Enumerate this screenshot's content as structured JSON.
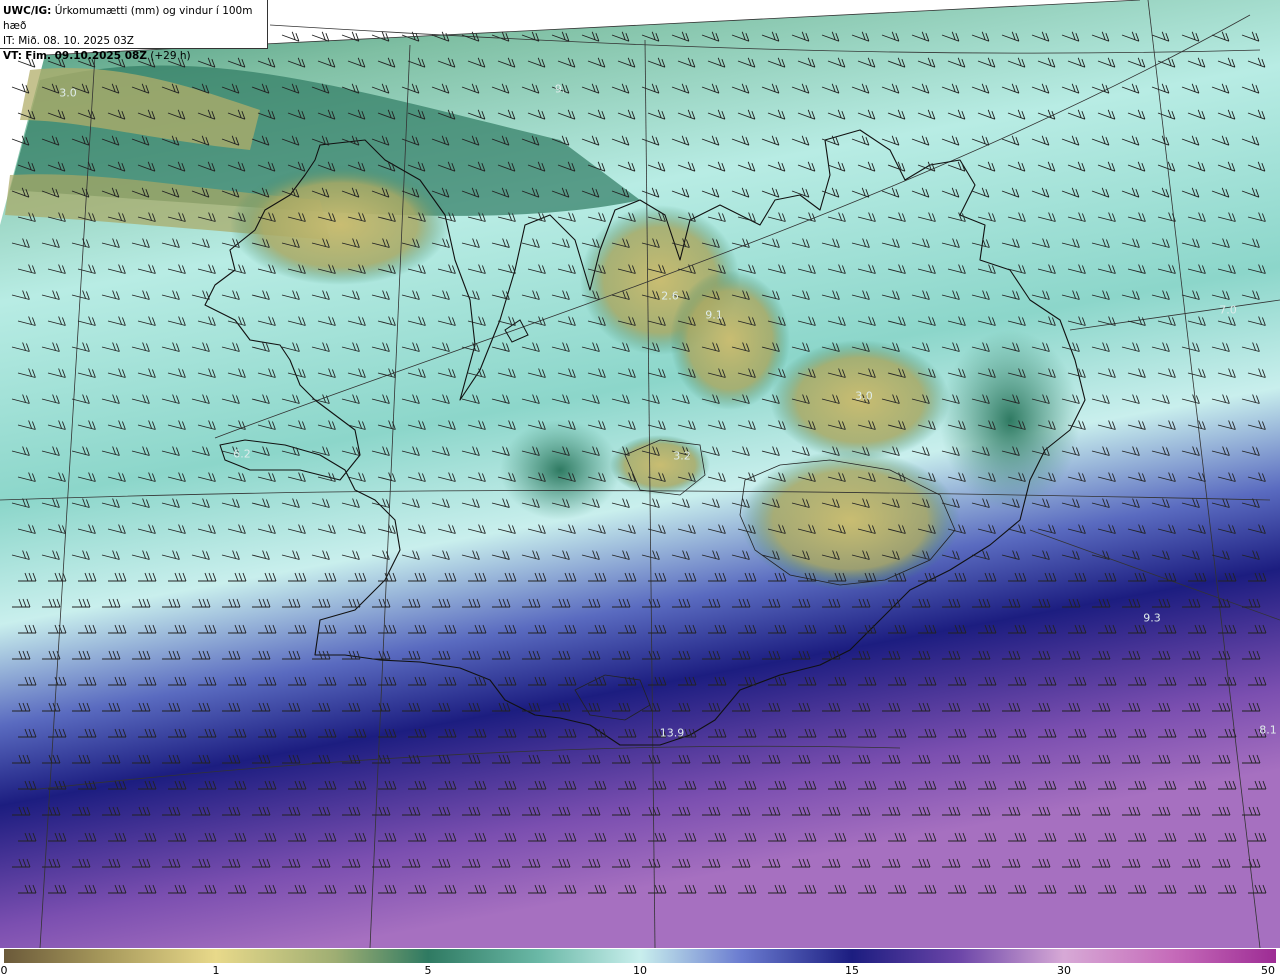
{
  "header": {
    "model": "UWC/IG:",
    "title": "Úrkomumætti (mm) og vindur í 100m hæð",
    "issue_time": "IT: Mið. 08. 10. 2025 03Z",
    "valid_prefix": "VT:",
    "valid_time": "Fim. 09.10.2025 08Z",
    "lead": "(+29 h)"
  },
  "colors": {
    "dry": "#7f7445",
    "low": "#c9bd72",
    "mid": "#3e8c72",
    "moist": "#b8ece4",
    "wet": "#2a2a8f",
    "very_wet": "#9d68b8",
    "extreme": "#b02c9b"
  },
  "map_values": [
    {
      "id": "v1",
      "text": "3.0"
    },
    {
      "id": "v2",
      "text": "9."
    },
    {
      "id": "v3",
      "text": "6.2"
    },
    {
      "id": "v4",
      "text": "2.6"
    },
    {
      "id": "v5",
      "text": "9.1"
    },
    {
      "id": "v6",
      "text": "3.2"
    },
    {
      "id": "v7",
      "text": "3.0"
    },
    {
      "id": "v8",
      "text": "7.0"
    },
    {
      "id": "v9",
      "text": "13.9"
    },
    {
      "id": "v10",
      "text": "9.3"
    },
    {
      "id": "v11",
      "text": "8.1"
    }
  ],
  "colorbar": {
    "ticks": [
      {
        "value": "0",
        "pos": 0.0
      },
      {
        "value": "1",
        "pos": 0.1667
      },
      {
        "value": "5",
        "pos": 0.3333
      },
      {
        "value": "10",
        "pos": 0.5
      },
      {
        "value": "15",
        "pos": 0.6667
      },
      {
        "value": "30",
        "pos": 0.8333
      },
      {
        "value": "50",
        "pos": 1.0
      }
    ]
  }
}
